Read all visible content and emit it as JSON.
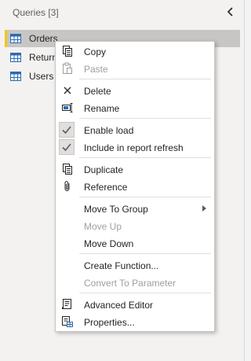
{
  "pane": {
    "title": "Queries [3]",
    "queries": [
      {
        "label": "Orders",
        "selected": true
      },
      {
        "label": "Returns",
        "selected": false
      },
      {
        "label": "Users",
        "selected": false
      }
    ]
  },
  "context_menu": {
    "copy": "Copy",
    "paste": "Paste",
    "delete": "Delete",
    "rename": "Rename",
    "enable_load": "Enable load",
    "include_refresh": "Include in report refresh",
    "duplicate": "Duplicate",
    "reference": "Reference",
    "move_to_group": "Move To Group",
    "move_up": "Move Up",
    "move_down": "Move Down",
    "create_function": "Create Function...",
    "convert_parameter": "Convert To Parameter",
    "advanced_editor": "Advanced Editor",
    "properties": "Properties..."
  },
  "colors": {
    "accent": "#f2c811",
    "table_icon": "#2b6cb0",
    "disabled_text": "#a19f9d"
  }
}
